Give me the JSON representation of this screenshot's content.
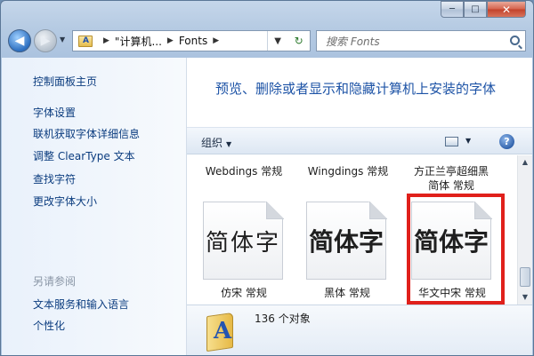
{
  "window": {
    "caption": {
      "minimize": "─",
      "maximize": "□",
      "close": "✕"
    }
  },
  "nav": {
    "back_glyph": "◀",
    "forward_glyph": "▶",
    "breadcrumbs": [
      "\"计算机...",
      "Fonts"
    ],
    "search_placeholder": "搜索 Fonts"
  },
  "left_pane": {
    "home": "控制面板主页",
    "tasks": [
      "字体设置",
      "联机获取字体详细信息",
      "调整 ClearType 文本",
      "查找字符",
      "更改字体大小"
    ],
    "see_also_title": "另请参阅",
    "see_also": [
      "文本服务和输入语言",
      "个性化"
    ]
  },
  "main": {
    "heading": "预览、删除或者显示和隐藏计算机上安装的字体",
    "toolbar": {
      "organize": "组织",
      "help": "?"
    },
    "top_row": [
      "Webdings 常规",
      "Wingdings 常规",
      "方正兰亭超细黑简体 常规"
    ],
    "tiles": [
      {
        "sample": "简体字",
        "label": "仿宋 常规",
        "style": "light"
      },
      {
        "sample": "简体字",
        "label": "黑体 常规",
        "style": "bold"
      },
      {
        "sample": "简体字",
        "label": "华文中宋 常规",
        "style": "bold"
      }
    ],
    "status": "136 个对象"
  },
  "colors": {
    "highlight": "#e0201b",
    "link": "#0b3c7f",
    "heading": "#1d53a6"
  }
}
